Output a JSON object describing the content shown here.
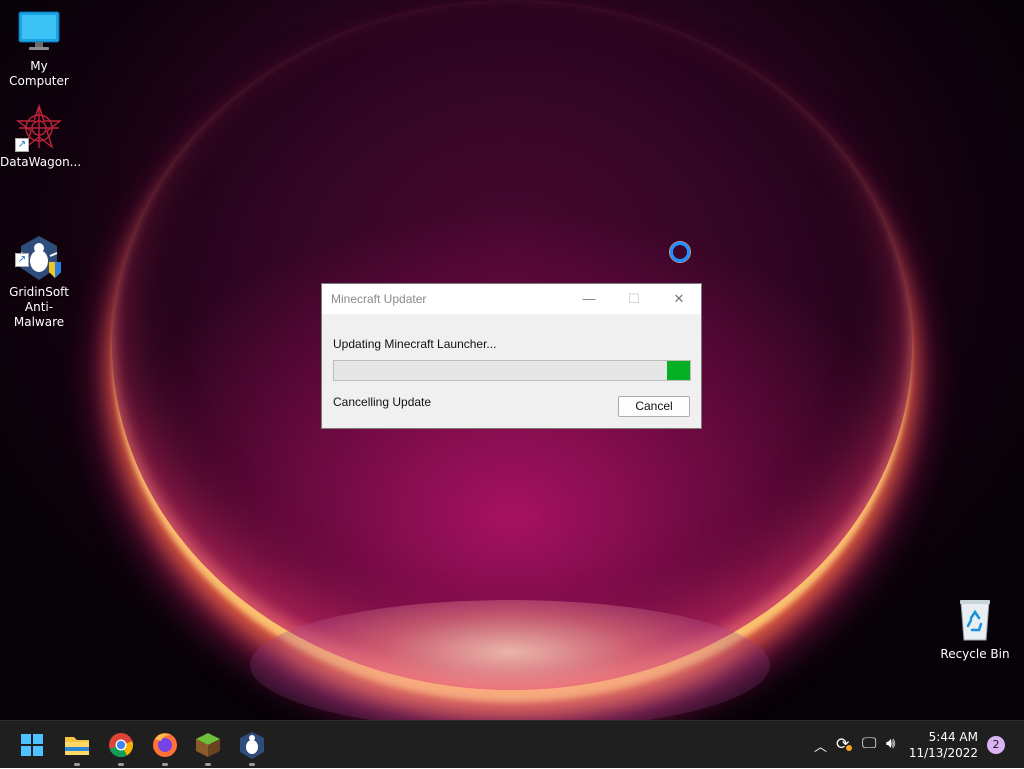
{
  "desktop": {
    "icons": [
      {
        "label": "My Computer"
      },
      {
        "label": "DataWagon..."
      },
      {
        "label": "GridinSoft\nAnti-Malware"
      },
      {
        "label": "Recycle Bin"
      }
    ]
  },
  "dialog": {
    "title": "Minecraft Updater",
    "status_line": "Updating Minecraft Launcher...",
    "progress": 0.065,
    "sub_status": "Cancelling Update",
    "cancel_label": "Cancel",
    "progress_color": "#06b025"
  },
  "taskbar": {
    "apps": [
      "start-icon",
      "file-explorer-icon",
      "chrome-icon",
      "firefox-icon",
      "minecraft-launcher-icon",
      "gridinsoft-icon"
    ],
    "tray": {
      "time": "5:44 AM",
      "date": "11/13/2022",
      "notifications": "2"
    }
  }
}
